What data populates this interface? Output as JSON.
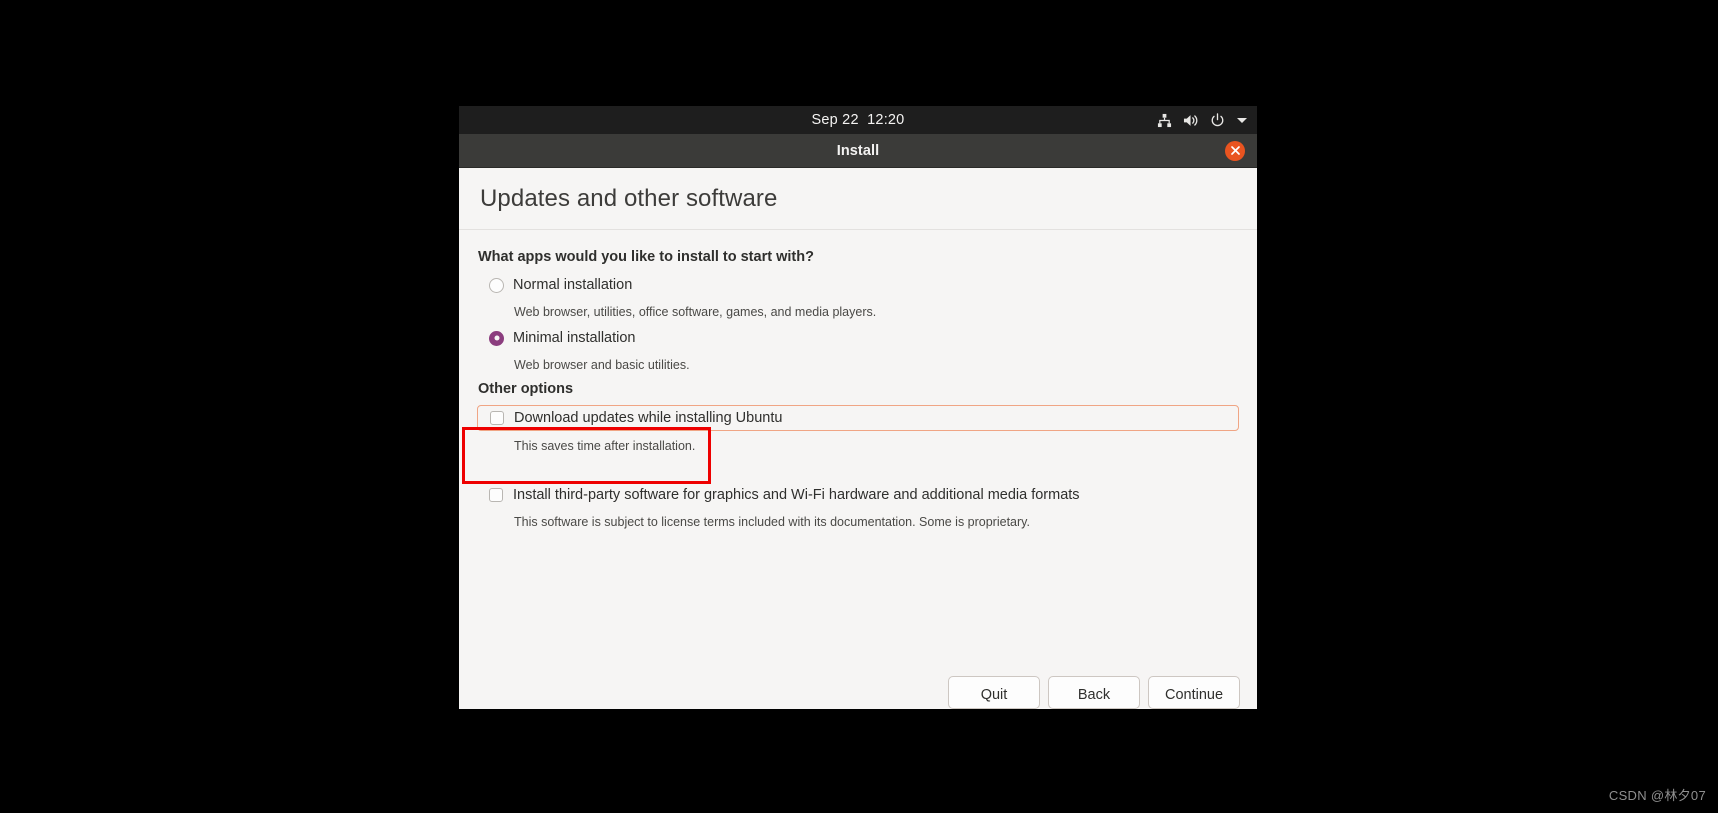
{
  "desktop": {
    "topbar": {
      "clock": "Sep 22  12:20",
      "tray_icons": [
        "network-icon",
        "volume-icon",
        "power-icon",
        "chevron-down-icon"
      ]
    }
  },
  "window": {
    "title": "Install",
    "close_label": "×"
  },
  "dialog": {
    "heading": "Updates and other software",
    "question": "What apps would you like to install to start with?",
    "install_options": [
      {
        "label": "Normal installation",
        "hint": "Web browser, utilities, office software, games, and media players.",
        "selected": false
      },
      {
        "label": "Minimal installation",
        "hint": "Web browser and basic utilities.",
        "selected": true
      }
    ],
    "other_options_title": "Other options",
    "checkboxes": [
      {
        "label": "Download updates while installing Ubuntu",
        "hint": "This saves time after installation.",
        "checked": false,
        "focused": true
      },
      {
        "label": "Install third-party software for graphics and Wi-Fi hardware and additional media formats",
        "hint": "This software is subject to license terms included with its documentation. Some is proprietary.",
        "checked": false,
        "focused": false
      }
    ],
    "buttons": {
      "quit": "Quit",
      "back": "Back",
      "continue": "Continue"
    }
  },
  "watermark": "CSDN @林夕07",
  "colors": {
    "accent_orange": "#e95420",
    "radio_purple": "#8b3d7e",
    "annotation_red": "#ee0000",
    "focus_border": "#f0a584",
    "dialog_bg": "#f6f5f4",
    "titlebar_bg": "#3b3b39",
    "topbar_bg": "#1e1e1e"
  }
}
